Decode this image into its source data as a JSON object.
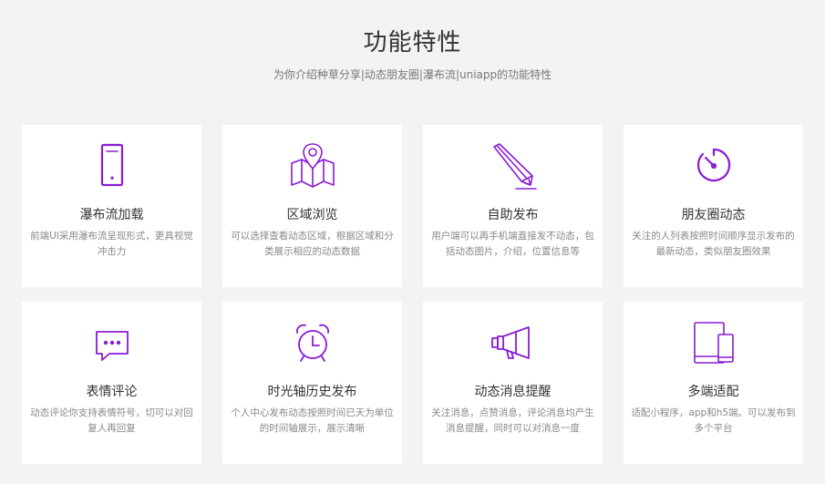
{
  "section": {
    "title": "功能特性",
    "subtitle": "为你介绍种草分享|动态朋友圈|瀑布流|uniapp的功能特性"
  },
  "accent_color": "#8a1bd6",
  "features": [
    {
      "icon": "phone-icon",
      "name": "瀑布流加载",
      "desc": "前端UI采用瀑布流呈现形式，更具视觉冲击力"
    },
    {
      "icon": "map-icon",
      "name": "区域浏览",
      "desc": "可以选择查看动态区域，根据区域和分类展示相应的动态数据"
    },
    {
      "icon": "pencil-icon",
      "name": "自助发布",
      "desc": "用户端可以再手机端直接发不动态，包括动态图片，介绍，位置信息等"
    },
    {
      "icon": "timer-icon",
      "name": "朋友圈动态",
      "desc": "关注的人列表按照时间顺序显示发布的最新动态，类似朋友圈效果"
    },
    {
      "icon": "chat-icon",
      "name": "表情评论",
      "desc": "动态评论你支持表情符号，切可以对回复人再回复"
    },
    {
      "icon": "alarm-clock-icon",
      "name": "时光轴历史发布",
      "desc": "个人中心发布动态按照时间已天为单位的时间轴展示，展示清晰"
    },
    {
      "icon": "megaphone-icon",
      "name": "动态消息提醒",
      "desc": "关注消息，点赞消息，评论消息均产生消息提醒，同时可以对消息一度"
    },
    {
      "icon": "devices-icon",
      "name": "多端适配",
      "desc": "适配小程序，app和h5端。可以发布到多个平台"
    }
  ]
}
